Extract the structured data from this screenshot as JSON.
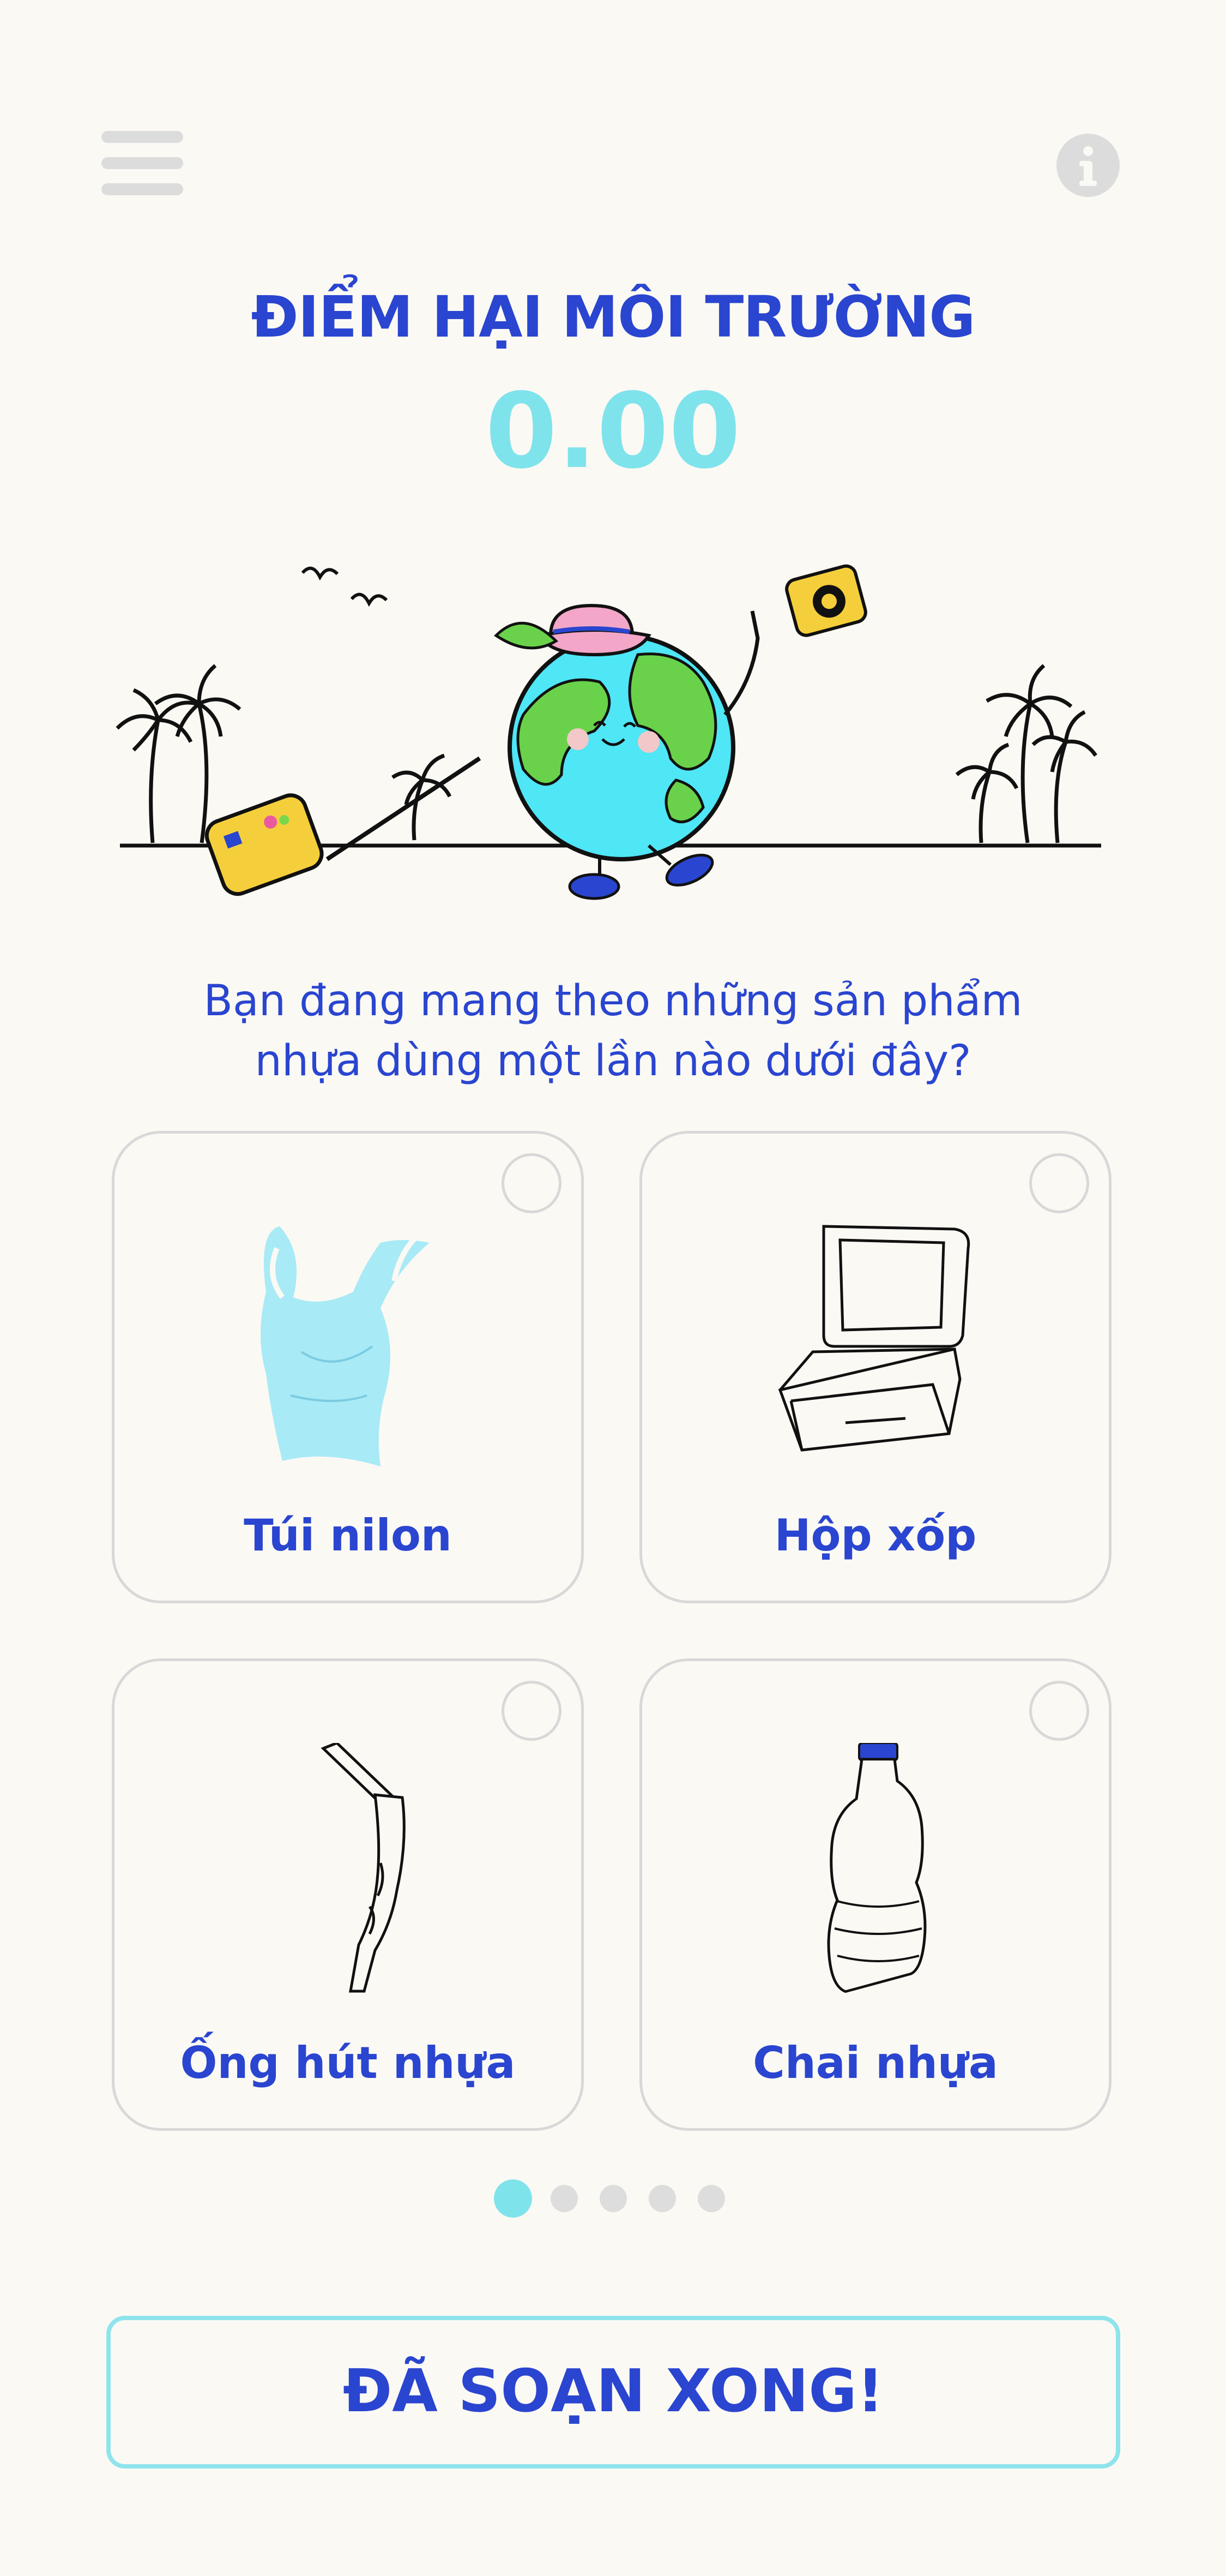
{
  "header": {
    "menu_icon": "hamburger-menu-icon",
    "info_icon": "info-icon"
  },
  "score": {
    "title": "ĐIỂM HẠI MÔI TRƯỜNG",
    "value": "0.00"
  },
  "question": {
    "line1": "Bạn đang mang theo những sản phẩm",
    "line2": "nhựa dùng một lần nào dưới đây?"
  },
  "items": [
    {
      "label": "Túi nilon",
      "icon": "plastic-bag-icon",
      "selected": false
    },
    {
      "label": "Hộp xốp",
      "icon": "foam-box-icon",
      "selected": false
    },
    {
      "label": "Ống hút nhựa",
      "icon": "plastic-straw-icon",
      "selected": false
    },
    {
      "label": "Chai nhựa",
      "icon": "plastic-bottle-icon",
      "selected": false
    }
  ],
  "pagination": {
    "current": 1,
    "total": 5
  },
  "done_button": {
    "label": "ĐÃ SOẠN XONG!"
  },
  "colors": {
    "background": "#fbf9f4",
    "primary": "#2a45d0",
    "accent": "#7fe3ec",
    "border": "#d8d8d8"
  }
}
